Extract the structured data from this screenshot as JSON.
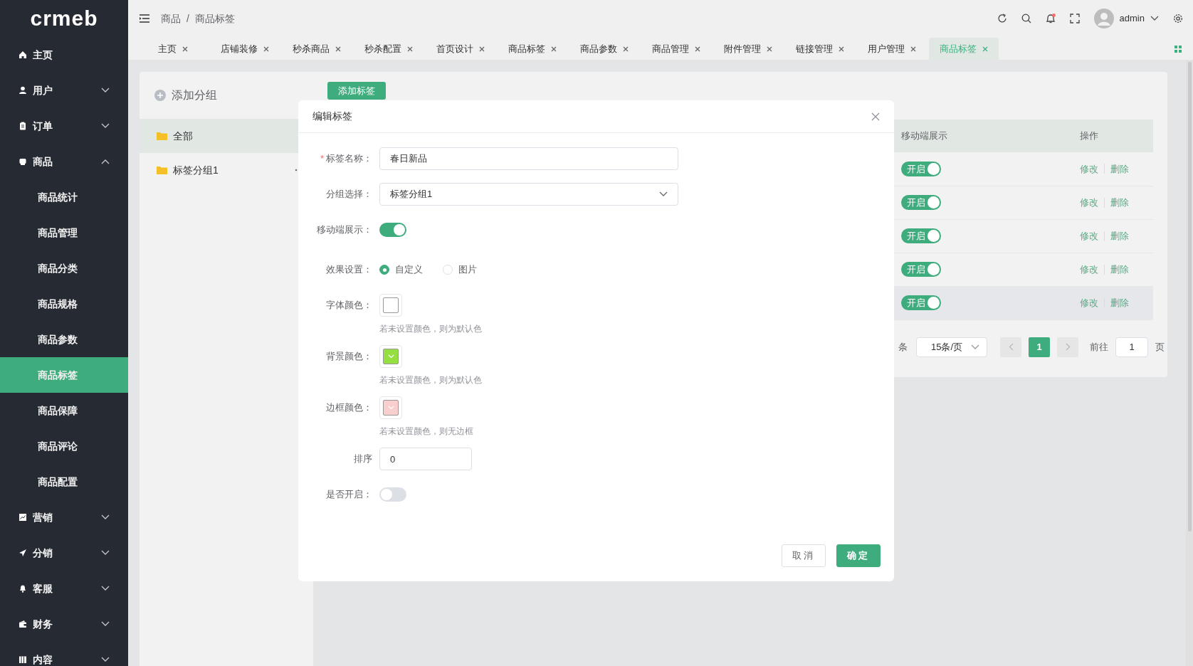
{
  "sidebar": {
    "logo": "crmeb",
    "items": [
      {
        "label": "主页",
        "kind": "link"
      },
      {
        "label": "用户",
        "kind": "group",
        "expanded": false
      },
      {
        "label": "订单",
        "kind": "group",
        "expanded": false
      },
      {
        "label": "商品",
        "kind": "group",
        "expanded": true,
        "children": [
          {
            "label": "商品统计",
            "selected": false
          },
          {
            "label": "商品管理",
            "selected": false
          },
          {
            "label": "商品分类",
            "selected": false
          },
          {
            "label": "商品规格",
            "selected": false
          },
          {
            "label": "商品参数",
            "selected": false
          },
          {
            "label": "商品标签",
            "selected": true
          },
          {
            "label": "商品保障",
            "selected": false
          },
          {
            "label": "商品评论",
            "selected": false
          },
          {
            "label": "商品配置",
            "selected": false
          }
        ]
      },
      {
        "label": "营销",
        "kind": "group",
        "expanded": false
      },
      {
        "label": "分销",
        "kind": "group",
        "expanded": false
      },
      {
        "label": "客服",
        "kind": "group",
        "expanded": false
      },
      {
        "label": "财务",
        "kind": "group",
        "expanded": false
      },
      {
        "label": "内容",
        "kind": "group",
        "expanded": false
      }
    ]
  },
  "header": {
    "breadcrumb": [
      "商品",
      "商品标签"
    ],
    "breadcrumb_separator": "/",
    "user": "admin",
    "has_notification": true
  },
  "tabs": [
    {
      "label": "主页",
      "selected": false
    },
    {
      "label": "店铺装修",
      "selected": false
    },
    {
      "label": "秒杀商品",
      "selected": false
    },
    {
      "label": "秒杀配置",
      "selected": false
    },
    {
      "label": "首页设计",
      "selected": false
    },
    {
      "label": "商品标签",
      "selected": false
    },
    {
      "label": "商品参数",
      "selected": false
    },
    {
      "label": "商品管理",
      "selected": false
    },
    {
      "label": "附件管理",
      "selected": false
    },
    {
      "label": "链接管理",
      "selected": false
    },
    {
      "label": "用户管理",
      "selected": false
    },
    {
      "label": "商品标签",
      "selected": true
    }
  ],
  "groups": {
    "add_label": "添加分组",
    "items": [
      {
        "label": "全部",
        "selected": true,
        "has_menu": false
      },
      {
        "label": "标签分组1",
        "selected": false,
        "has_menu": true
      }
    ]
  },
  "add_button": "添加标签",
  "table": {
    "columns": [
      "移动端展示",
      "操作"
    ],
    "rows": [
      {
        "display": {
          "on": true,
          "label": "开启"
        },
        "actions": [
          "修改",
          "删除"
        ],
        "highlighted": false
      },
      {
        "display": {
          "on": true,
          "label": "开启"
        },
        "actions": [
          "修改",
          "删除"
        ],
        "highlighted": false
      },
      {
        "display": {
          "on": true,
          "label": "开启"
        },
        "actions": [
          "修改",
          "删除"
        ],
        "highlighted": false
      },
      {
        "display": {
          "on": true,
          "label": "开启"
        },
        "actions": [
          "修改",
          "删除"
        ],
        "highlighted": false
      },
      {
        "display": {
          "on": true,
          "label": "开启"
        },
        "actions": [
          "修改",
          "删除"
        ],
        "highlighted": true
      }
    ]
  },
  "pagination": {
    "total_suffix": "条",
    "page_size": "15条/页",
    "pages": [
      {
        "label": "1",
        "selected": true
      }
    ],
    "goto_label": "前往",
    "goto_value": "1",
    "page_suffix": "页"
  },
  "modal": {
    "title": "编辑标签",
    "fields": [
      {
        "kind": "text",
        "label": "标签名称：",
        "required_mark": "*",
        "value": "春日新品"
      },
      {
        "kind": "select",
        "label": "分组选择：",
        "value": "标签分组1"
      },
      {
        "kind": "switch",
        "label": "移动端展示：",
        "on": true
      },
      {
        "kind": "radio",
        "label": "效果设置：",
        "options": [
          {
            "label": "自定义",
            "selected": true
          },
          {
            "label": "图片",
            "selected": false
          }
        ]
      },
      {
        "kind": "color",
        "label": "字体颜色：",
        "set": false,
        "hint": "若未设置颜色，则为默认色"
      },
      {
        "kind": "color",
        "label": "背景颜色：",
        "set": true,
        "color": "#95e040",
        "hint": "若未设置颜色，则为默认色"
      },
      {
        "kind": "color",
        "label": "边框颜色：",
        "set": true,
        "color": "#f8cfcc",
        "hint": "若未设置颜色，则无边框"
      },
      {
        "kind": "number",
        "label": "排序",
        "value": "0"
      },
      {
        "kind": "switch",
        "label": "是否开启：",
        "on": false
      }
    ],
    "buttons": [
      {
        "label": "取消",
        "primary": false
      },
      {
        "label": "确定",
        "primary": true
      }
    ]
  }
}
